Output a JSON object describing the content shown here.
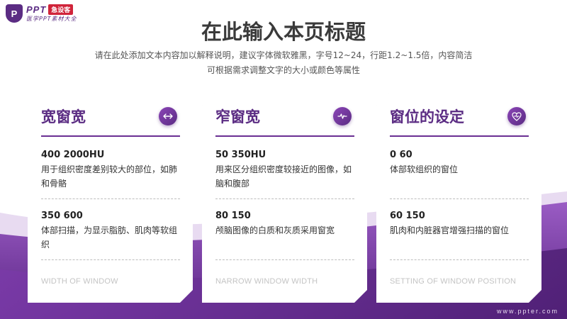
{
  "logo": {
    "mark": "P",
    "name": "PPT",
    "tag": "急设客",
    "slogan": "医学PPT素材大全"
  },
  "header": {
    "title": "在此输入本页标题",
    "subtitle_line1": "请在此处添加文本内容加以解释说明，建议字体微软雅黑，字号12~24，行距1.2~1.5倍，内容简洁",
    "subtitle_line2": "可根据需求调整文字的大小或颜色等属性"
  },
  "cards": [
    {
      "title": "宽窗宽",
      "icon": "arrows-horizontal-icon",
      "sections": [
        {
          "value": "400    2000HU",
          "desc": "用于组织密度差别较大的部位，如肺和骨骼"
        },
        {
          "value": "350    600",
          "desc": "体部扫描，为显示脂肪、肌肉等软组织"
        }
      ],
      "footer": "WIDTH OF WINDOW"
    },
    {
      "title": "窄窗宽",
      "icon": "pulse-icon",
      "sections": [
        {
          "value": "50    350HU",
          "desc": "用来区分组织密度较接近的图像，如脑和腹部"
        },
        {
          "value": "80    150",
          "desc": "颅脑图像的白质和灰质采用窗宽"
        }
      ],
      "footer": "NARROW WINDOW WIDTH"
    },
    {
      "title": "窗位的设定",
      "icon": "heart-pulse-icon",
      "sections": [
        {
          "value": "0    60",
          "desc": "体部软组织的窗位"
        },
        {
          "value": "60    150",
          "desc": "肌肉和内脏器官增强扫描的窗位"
        }
      ],
      "footer": "SETTING OF WINDOW POSITION"
    }
  ],
  "footer_url": "www.ppter.com",
  "colors": {
    "accent": "#5b2c83",
    "wave_dark": "#5a2584",
    "wave_light": "#9a5cc4"
  }
}
